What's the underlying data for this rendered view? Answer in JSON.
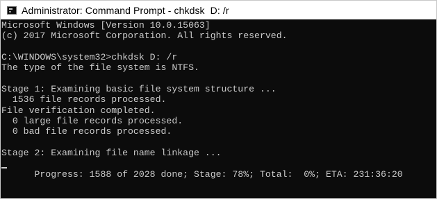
{
  "window": {
    "title": "Administrator: Command Prompt - chkdsk  D: /r",
    "icon": "cmd-icon"
  },
  "console": {
    "lines": [
      "Microsoft Windows [Version 10.0.15063]",
      "(c) 2017 Microsoft Corporation. All rights reserved.",
      "",
      "C:\\WINDOWS\\system32>chkdsk D: /r",
      "The type of the file system is NTFS.",
      "",
      "Stage 1: Examining basic file system structure ...",
      "  1536 file records processed.",
      "File verification completed.",
      "  0 large file records processed.",
      "  0 bad file records processed.",
      "",
      "Stage 2: Examining file name linkage ...",
      "Progress: 1588 of 2028 done; Stage: 78%; Total:  0%; ETA: 231:36:20"
    ]
  }
}
